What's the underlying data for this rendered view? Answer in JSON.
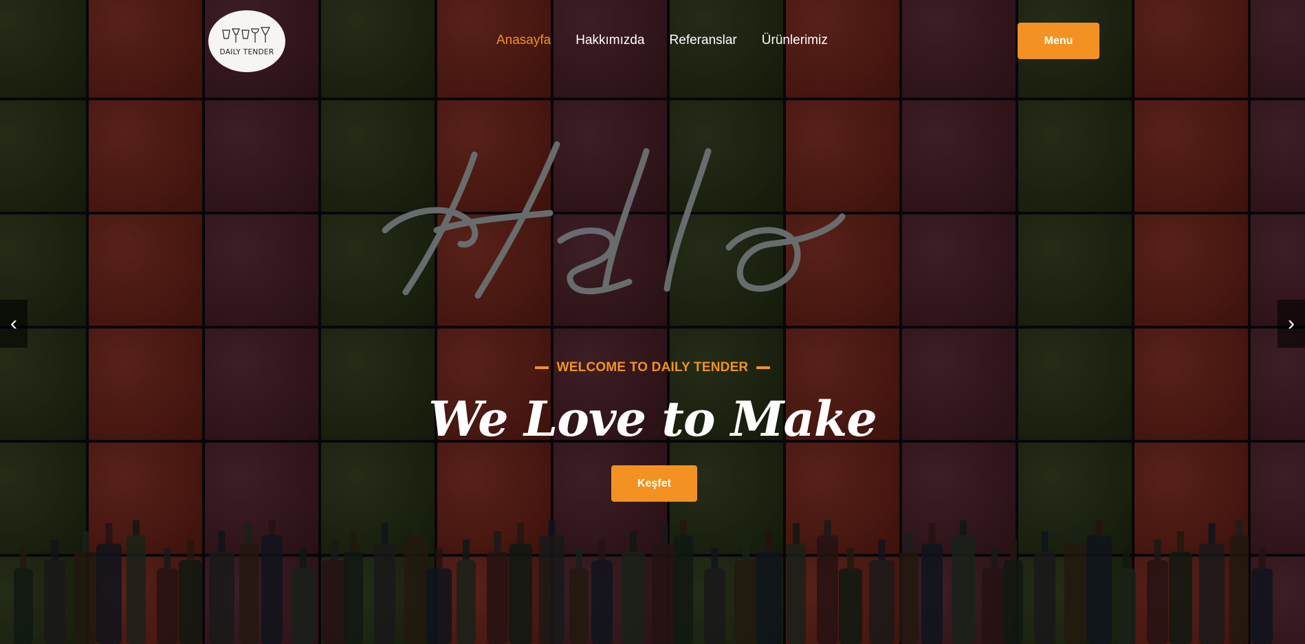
{
  "logo": {
    "text": "DAILY TENDER",
    "icon": "glasses-logo-icon"
  },
  "nav": {
    "items": [
      "Anasayfa",
      "Hakkımızda",
      "Referanslar",
      "Ürünlerimiz"
    ],
    "active_index": 0
  },
  "header": {
    "menu_button": "Menu"
  },
  "hero": {
    "kicker": "WELCOME TO DAILY TENDER",
    "headline": "We Love to Make",
    "cta": "Keşfet",
    "neon_sign": "Hello"
  },
  "slider": {
    "prev_icon": "chevron-left-icon",
    "next_icon": "chevron-right-icon"
  },
  "colors": {
    "accent": "#f39222",
    "text": "#ffffff"
  }
}
